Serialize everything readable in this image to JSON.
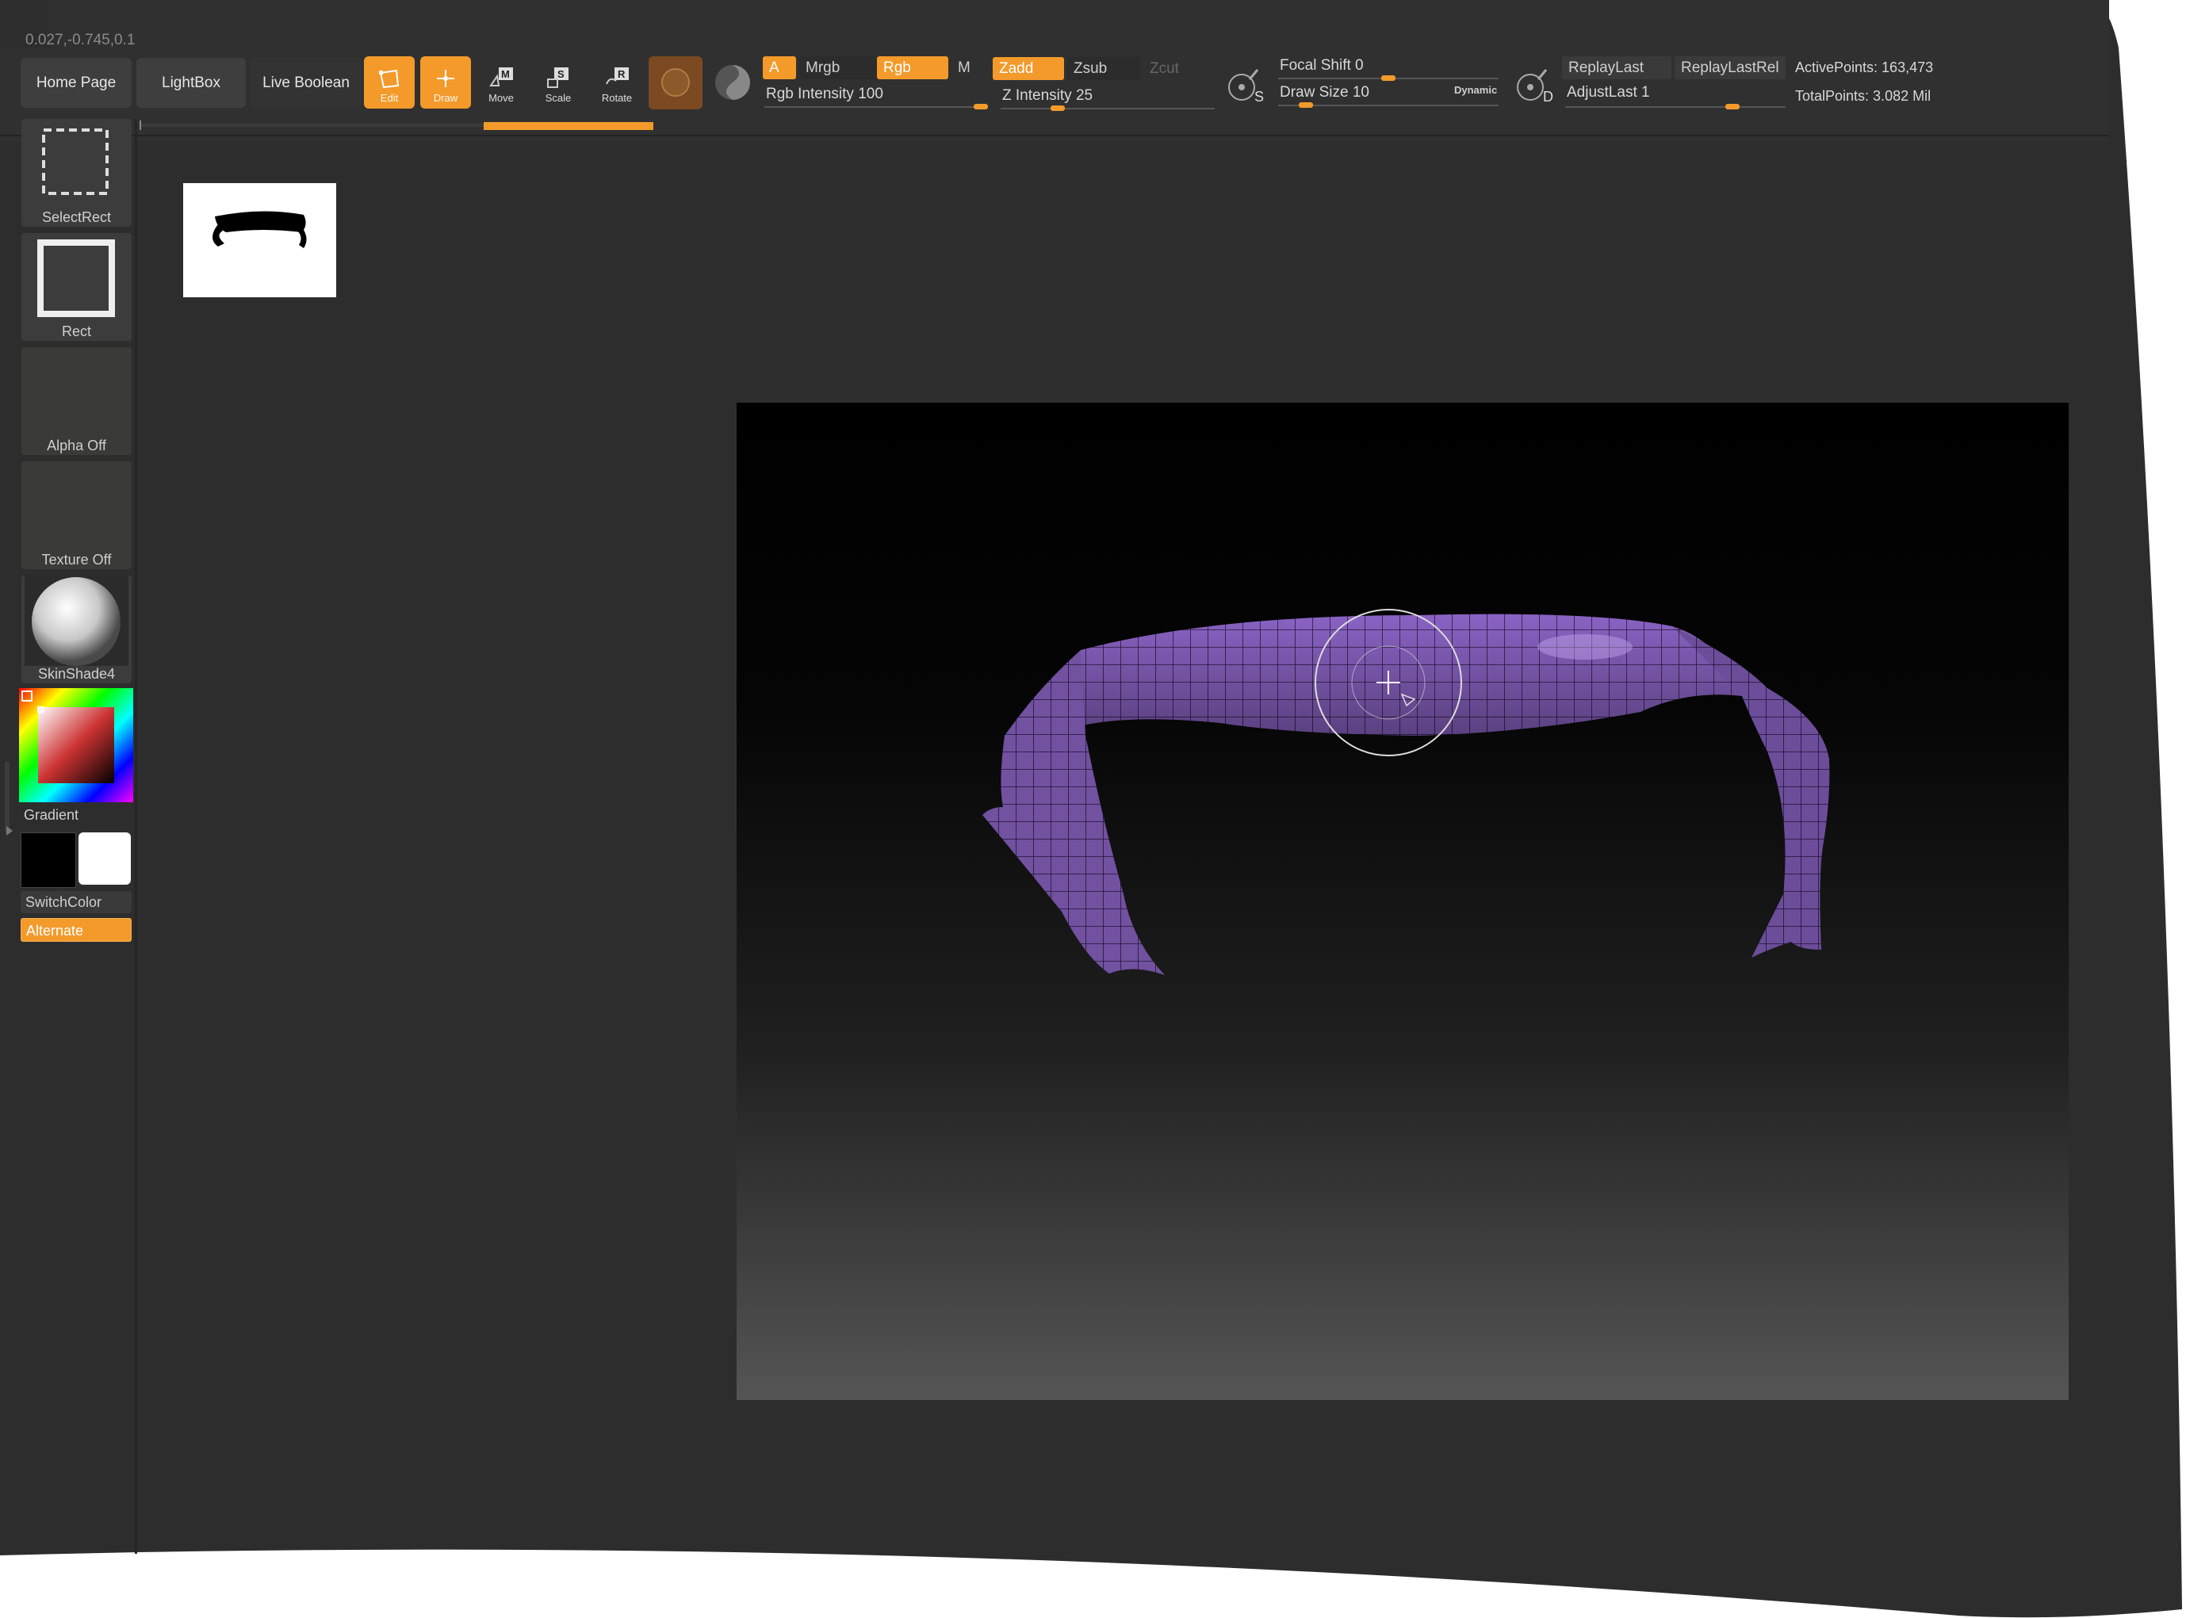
{
  "status": {
    "coords": "0.027,-0.745,0.1"
  },
  "toolbar": {
    "home_page": "Home Page",
    "lightbox": "LightBox",
    "live_boolean": "Live Boolean",
    "edit": "Edit",
    "draw": "Draw",
    "move": "Move",
    "scale": "Scale",
    "rotate": "Rotate",
    "a_label": "A",
    "mrgb": "Mrgb",
    "rgb": "Rgb",
    "m": "M",
    "zadd": "Zadd",
    "zsub": "Zsub",
    "zcut": "Zcut",
    "rgb_intensity_label": "Rgb Intensity",
    "rgb_intensity_value": "100",
    "z_intensity_label": "Z Intensity",
    "z_intensity_value": "25",
    "focal_shift_label": "Focal Shift",
    "focal_shift_value": "0",
    "draw_size_label": "Draw Size",
    "draw_size_value": "10",
    "dynamic": "Dynamic",
    "replay_last": "ReplayLast",
    "replay_last_rel": "ReplayLastRel",
    "adjust_last_label": "AdjustLast",
    "adjust_last_value": "1",
    "active_points": "ActivePoints: 163,473",
    "total_points": "TotalPoints: 3.082 Mil",
    "s_icon_letter": "S",
    "d_icon_letter": "D"
  },
  "sidebar": {
    "select_rect": "SelectRect",
    "rect": "Rect",
    "alpha_off": "Alpha Off",
    "texture_off": "Texture Off",
    "material": "SkinShade4",
    "gradient": "Gradient",
    "switch_color": "SwitchColor",
    "alternate": "Alternate"
  },
  "colors": {
    "accent": "#f39a2b",
    "mesh": "#8a63c4",
    "panel": "#2b2b2b"
  },
  "sliders": {
    "rgb_intensity": 1.0,
    "z_intensity": 0.25,
    "focal_shift": 0.5,
    "draw_size": 0.1,
    "adjust_last": 1.0
  }
}
